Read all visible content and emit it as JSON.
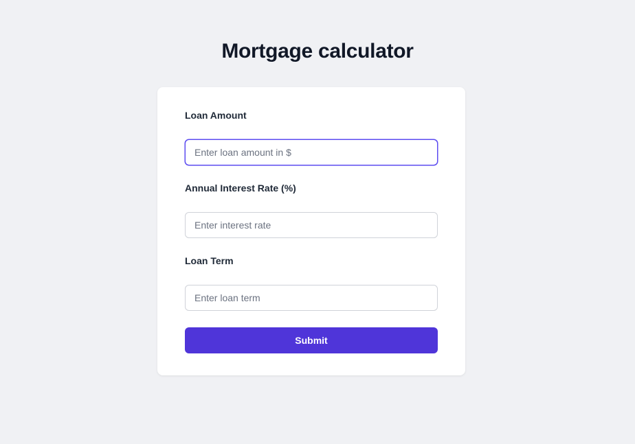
{
  "page": {
    "title": "Mortgage calculator"
  },
  "form": {
    "loan_amount": {
      "label": "Loan Amount",
      "placeholder": "Enter loan amount in $",
      "value": ""
    },
    "interest_rate": {
      "label": "Annual Interest Rate (%)",
      "placeholder": "Enter interest rate",
      "value": ""
    },
    "loan_term": {
      "label": "Loan Term",
      "placeholder": "Enter loan term",
      "value": ""
    },
    "submit_label": "Submit"
  },
  "colors": {
    "accent": "#4f35d9",
    "focus_border": "#5b4bf0",
    "background": "#f0f1f4"
  }
}
